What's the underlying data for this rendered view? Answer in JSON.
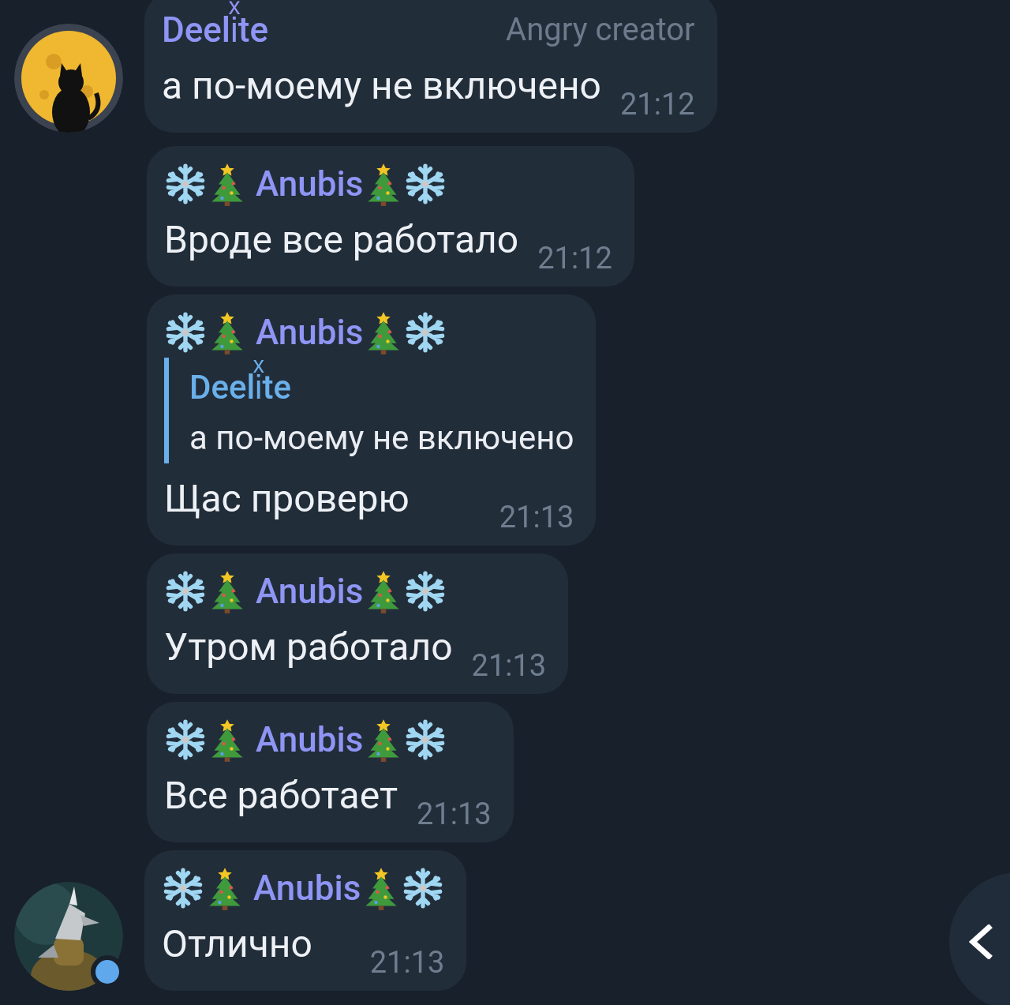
{
  "messages": [
    {
      "sender": "Deeliͯte",
      "decorated": false,
      "badge": "Angry creator",
      "text": "а по-моему не включено",
      "time": "21:12",
      "avatar": {
        "kind": "picture",
        "online": false
      }
    },
    {
      "sender": "Anubis",
      "decorated": true,
      "text": "Вроде все работало",
      "time": "21:12"
    },
    {
      "sender": "Anubis",
      "decorated": true,
      "reply": {
        "sender": "Deeliͯte",
        "text": "а по-моему не включено"
      },
      "text": "Щас проверю",
      "time": "21:13"
    },
    {
      "sender": "Anubis",
      "decorated": true,
      "text": "Утром работало",
      "time": "21:13"
    },
    {
      "sender": "Anubis",
      "decorated": true,
      "text": "Все работает",
      "time": "21:13"
    },
    {
      "sender": "Anubis",
      "decorated": true,
      "text": "Отлично",
      "time": "21:13",
      "avatar": {
        "kind": "picture",
        "online": true
      }
    }
  ]
}
